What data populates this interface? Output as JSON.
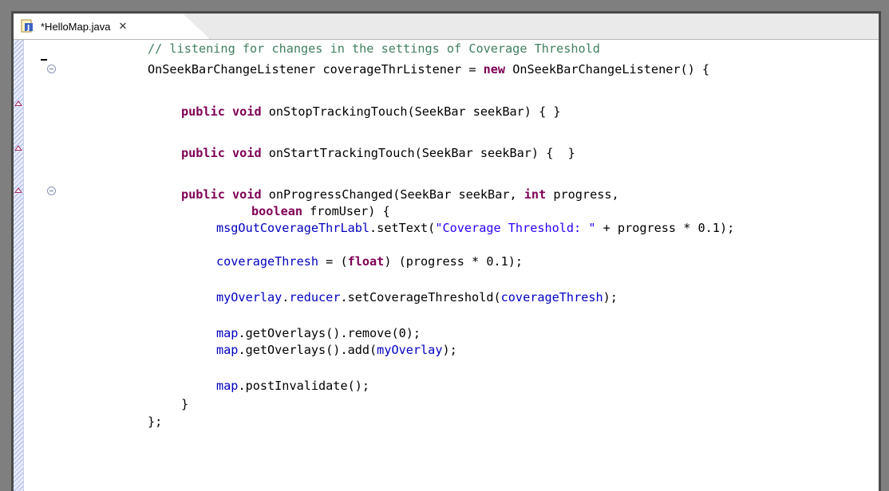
{
  "tab": {
    "label": "*HelloMap.java",
    "close_glyph": "✕",
    "icon": "java-file-icon"
  },
  "editor": {
    "lines": [
      {
        "id": "l1",
        "segs": [
          {
            "t": "// listening for changes in the settings of Coverage Threshold",
            "c": "cm"
          }
        ]
      },
      {
        "id": "l2",
        "segs": [
          {
            "t": "OnSeekBarChangeListener coverageThrListener = ",
            "c": ""
          },
          {
            "t": "new",
            "c": "kw"
          },
          {
            "t": " OnSeekBarChangeListener() {",
            "c": ""
          }
        ]
      },
      {
        "id": "l3",
        "segs": [
          {
            "t": "public",
            "c": "kw"
          },
          {
            "t": " ",
            "c": ""
          },
          {
            "t": "void",
            "c": "kw"
          },
          {
            "t": " onStopTrackingTouch(SeekBar seekBar) { }",
            "c": ""
          }
        ]
      },
      {
        "id": "l4",
        "segs": [
          {
            "t": "public",
            "c": "kw"
          },
          {
            "t": " ",
            "c": ""
          },
          {
            "t": "void",
            "c": "kw"
          },
          {
            "t": " onStartTrackingTouch(SeekBar seekBar) {  }",
            "c": ""
          }
        ]
      },
      {
        "id": "l5",
        "segs": [
          {
            "t": "public",
            "c": "kw"
          },
          {
            "t": " ",
            "c": ""
          },
          {
            "t": "void",
            "c": "kw"
          },
          {
            "t": " onProgressChanged(SeekBar seekBar, ",
            "c": ""
          },
          {
            "t": "int",
            "c": "kw"
          },
          {
            "t": " progress,",
            "c": ""
          }
        ]
      },
      {
        "id": "l6",
        "segs": [
          {
            "t": "boolean",
            "c": "kw"
          },
          {
            "t": " fromUser) {",
            "c": ""
          }
        ]
      },
      {
        "id": "l7",
        "segs": [
          {
            "t": "msgOutCoverageThrLabl",
            "c": "fld"
          },
          {
            "t": ".setText(",
            "c": ""
          },
          {
            "t": "\"Coverage Threshold: \"",
            "c": "str"
          },
          {
            "t": " + progress * 0.1);",
            "c": ""
          }
        ]
      },
      {
        "id": "l8",
        "segs": [
          {
            "t": "coverageThresh",
            "c": "fld"
          },
          {
            "t": " = (",
            "c": ""
          },
          {
            "t": "float",
            "c": "kw"
          },
          {
            "t": ") (progress * 0.1);",
            "c": ""
          }
        ]
      },
      {
        "id": "l9",
        "segs": [
          {
            "t": "myOverlay",
            "c": "fld"
          },
          {
            "t": ".",
            "c": ""
          },
          {
            "t": "reducer",
            "c": "fld"
          },
          {
            "t": ".setCoverageThreshold(",
            "c": ""
          },
          {
            "t": "coverageThresh",
            "c": "fld"
          },
          {
            "t": ");",
            "c": ""
          }
        ]
      },
      {
        "id": "l10",
        "segs": [
          {
            "t": "map",
            "c": "fld"
          },
          {
            "t": ".getOverlays().remove(0);",
            "c": ""
          }
        ]
      },
      {
        "id": "l11",
        "segs": [
          {
            "t": "map",
            "c": "fld"
          },
          {
            "t": ".getOverlays().add(",
            "c": ""
          },
          {
            "t": "myOverlay",
            "c": "fld"
          },
          {
            "t": ");",
            "c": ""
          }
        ]
      },
      {
        "id": "l12",
        "segs": [
          {
            "t": "map",
            "c": "fld"
          },
          {
            "t": ".postInvalidate();",
            "c": ""
          }
        ]
      },
      {
        "id": "l13",
        "segs": [
          {
            "t": "}",
            "c": ""
          }
        ]
      },
      {
        "id": "l14",
        "segs": [
          {
            "t": "};",
            "c": ""
          }
        ]
      }
    ]
  },
  "colors": {
    "keyword": "#7f0055",
    "comment": "#3f7f5f",
    "string": "#2a00ff",
    "field": "#0000c0"
  }
}
